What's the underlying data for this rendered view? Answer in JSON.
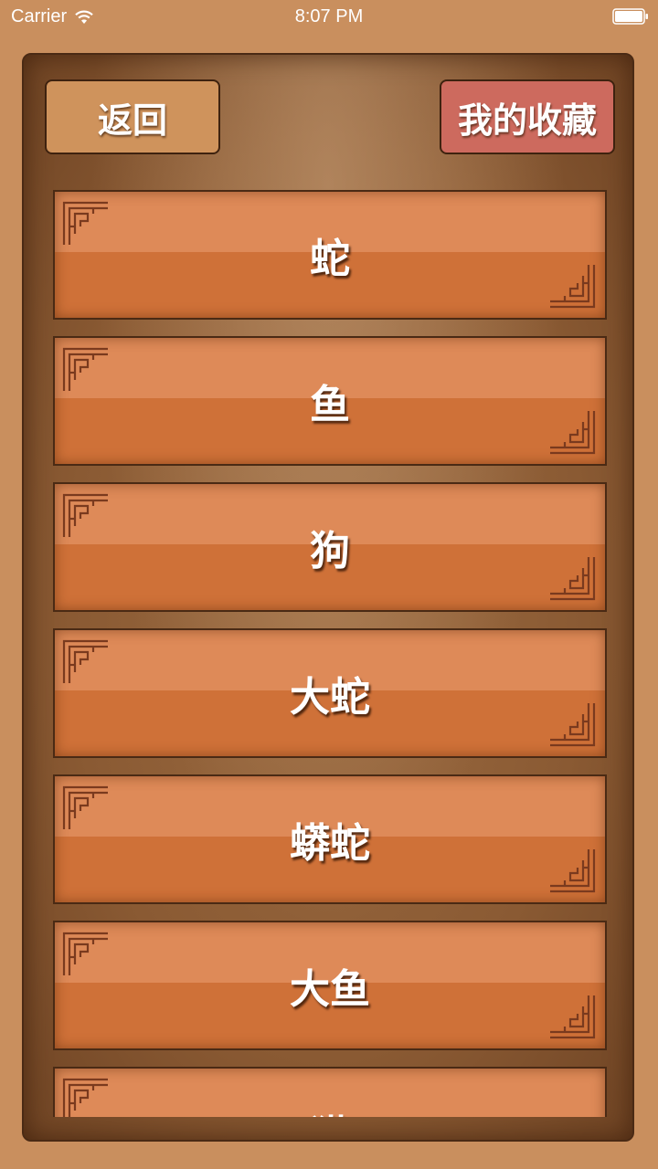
{
  "status_bar": {
    "carrier": "Carrier",
    "time": "8:07 PM"
  },
  "header": {
    "back_label": "返回",
    "favorites_label": "我的收藏"
  },
  "colors": {
    "background": "#c98f5e",
    "back_button": "#cf935c",
    "favorites_button": "#cd6a5e",
    "item_top": "#de8a58",
    "item_bottom": "#cf7138",
    "ornament": "#7a3a1e"
  },
  "list": {
    "items": [
      {
        "label": "蛇"
      },
      {
        "label": "鱼"
      },
      {
        "label": "狗"
      },
      {
        "label": "大蛇"
      },
      {
        "label": "蟒蛇"
      },
      {
        "label": "大鱼"
      },
      {
        "label": "猫"
      }
    ]
  }
}
